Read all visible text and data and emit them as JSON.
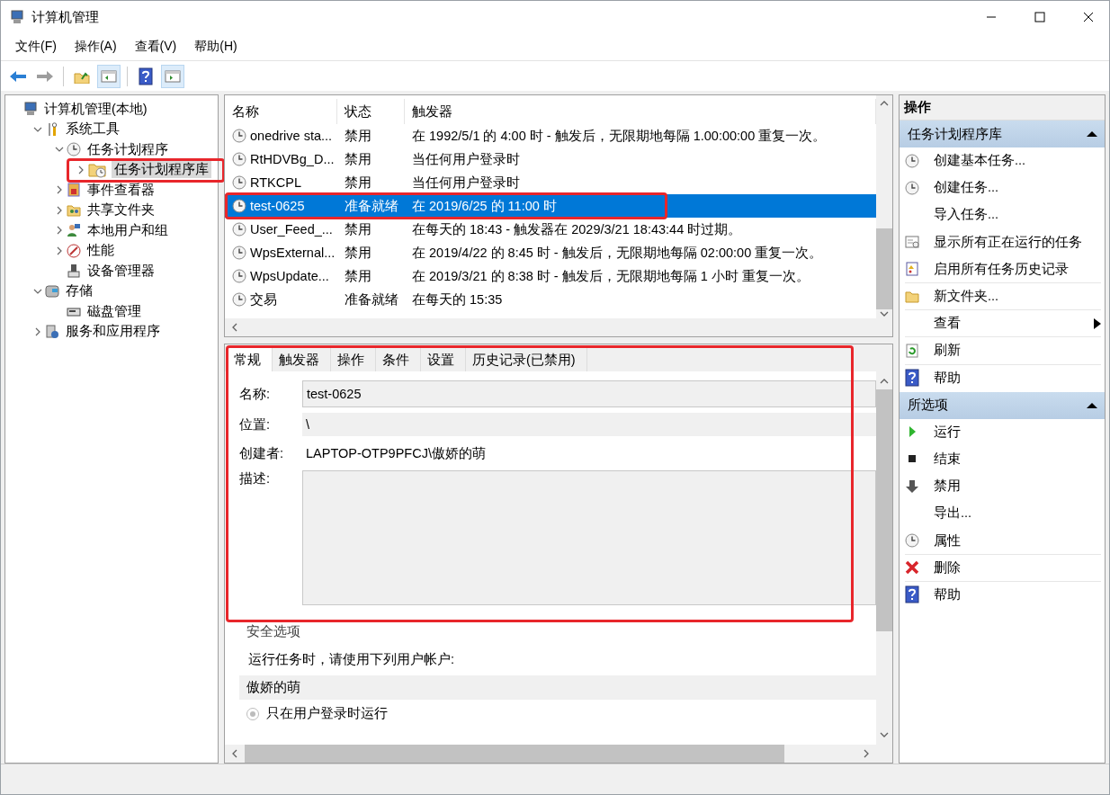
{
  "window": {
    "title": "计算机管理"
  },
  "menu": [
    {
      "label": "文件(F)"
    },
    {
      "label": "操作(A)"
    },
    {
      "label": "查看(V)"
    },
    {
      "label": "帮助(H)"
    }
  ],
  "toolbar": [
    {
      "disabled": false,
      "pressed": false
    },
    {
      "disabled": true,
      "pressed": false
    },
    {
      "disabled": false,
      "pressed": false
    },
    {
      "disabled": false,
      "pressed": true
    },
    {
      "disabled": false,
      "pressed": false
    },
    {
      "disabled": false,
      "pressed": true
    }
  ],
  "tree": [
    {
      "label": "计算机管理(本地)",
      "selected": false,
      "children": [
        {
          "label": "系统工具",
          "expanded": true,
          "selected": false,
          "children": [
            {
              "label": "任务计划程序",
              "expanded": true,
              "selected": false,
              "children": [
                {
                  "label": "任务计划程序库",
                  "expanded": false,
                  "selected": true,
                  "highlighted": true
                }
              ]
            },
            {
              "label": "事件查看器",
              "expanded": false,
              "selected": false
            },
            {
              "label": "共享文件夹",
              "expanded": false,
              "selected": false
            },
            {
              "label": "本地用户和组",
              "expanded": false,
              "selected": false
            },
            {
              "label": "性能",
              "expanded": false,
              "selected": false
            },
            {
              "label": "设备管理器",
              "selected": false
            }
          ]
        },
        {
          "label": "存储",
          "expanded": true,
          "selected": false,
          "children": [
            {
              "label": "磁盘管理",
              "selected": false
            }
          ]
        },
        {
          "label": "服务和应用程序",
          "expanded": false,
          "selected": false
        }
      ]
    }
  ],
  "table": {
    "columns": [
      "名称",
      "状态",
      "触发器"
    ],
    "rows": [
      {
        "name": "onedrive sta...",
        "status": "禁用",
        "trigger": "在 1992/5/1 的 4:00 时 - 触发后，无限期地每隔 1.00:00:00 重复一次。",
        "selected": false
      },
      {
        "name": "RtHDVBg_D...",
        "status": "禁用",
        "trigger": "当任何用户登录时",
        "selected": false
      },
      {
        "name": "RTKCPL",
        "status": "禁用",
        "trigger": "当任何用户登录时",
        "selected": false
      },
      {
        "name": "test-0625",
        "status": "准备就绪",
        "trigger": "在 2019/6/25 的 11:00 时",
        "selected": true,
        "highlighted": true
      },
      {
        "name": "User_Feed_...",
        "status": "禁用",
        "trigger": "在每天的 18:43 - 触发器在 2029/3/21 18:43:44 时过期。",
        "selected": false
      },
      {
        "name": "WpsExternal...",
        "status": "禁用",
        "trigger": "在 2019/4/22 的 8:45 时 - 触发后，无限期地每隔 02:00:00 重复一次。",
        "selected": false
      },
      {
        "name": "WpsUpdate...",
        "status": "禁用",
        "trigger": "在 2019/3/21 的 8:38 时 - 触发后，无限期地每隔 1 小时 重复一次。",
        "selected": false
      },
      {
        "name": "交易",
        "status": "准备就绪",
        "trigger": "在每天的 15:35",
        "selected": false
      }
    ]
  },
  "details": {
    "highlighted": true,
    "tabs": [
      {
        "label": "常规",
        "selected": true
      },
      {
        "label": "触发器",
        "selected": false
      },
      {
        "label": "操作",
        "selected": false
      },
      {
        "label": "条件",
        "selected": false
      },
      {
        "label": "设置",
        "selected": false
      },
      {
        "label": "历史记录(已禁用)",
        "selected": false
      }
    ],
    "name_label": "名称:",
    "name_value": "test-0625",
    "location_label": "位置:",
    "location_value": "\\",
    "author_label": "创建者:",
    "author_value": "LAPTOP-OTP9PFCJ\\傲娇的萌",
    "description_label": "描述:",
    "security": {
      "title": "安全选项",
      "prompt": "运行任务时，请使用下列用户帐户:",
      "account": "傲娇的萌",
      "options": [
        {
          "label": "只在用户登录时运行",
          "selected": true,
          "disabled": true
        }
      ]
    }
  },
  "actions": {
    "title": "操作",
    "sections": [
      {
        "title": "任务计划程序库",
        "expanded": true,
        "items": [
          {
            "label": "创建基本任务...",
            "submenu": false,
            "divider": false
          },
          {
            "label": "创建任务...",
            "submenu": false,
            "divider": false
          },
          {
            "label": "导入任务...",
            "submenu": false,
            "divider": false
          },
          {
            "label": "显示所有正在运行的任务",
            "submenu": false,
            "divider": false
          },
          {
            "label": "启用所有任务历史记录",
            "submenu": false,
            "divider": true
          },
          {
            "label": "新文件夹...",
            "submenu": false,
            "divider": true
          },
          {
            "label": "查看",
            "submenu": true,
            "divider": true
          },
          {
            "label": "刷新",
            "submenu": false,
            "divider": true
          },
          {
            "label": "帮助",
            "submenu": false,
            "divider": false
          }
        ]
      },
      {
        "title": "所选项",
        "expanded": true,
        "items": [
          {
            "label": "运行",
            "submenu": false,
            "divider": false
          },
          {
            "label": "结束",
            "submenu": false,
            "divider": false
          },
          {
            "label": "禁用",
            "submenu": false,
            "divider": false
          },
          {
            "label": "导出...",
            "submenu": false,
            "divider": false
          },
          {
            "label": "属性",
            "submenu": false,
            "divider": true
          },
          {
            "label": "删除",
            "submenu": false,
            "divider": true
          },
          {
            "label": "帮助",
            "submenu": false,
            "divider": false
          }
        ]
      }
    ]
  }
}
